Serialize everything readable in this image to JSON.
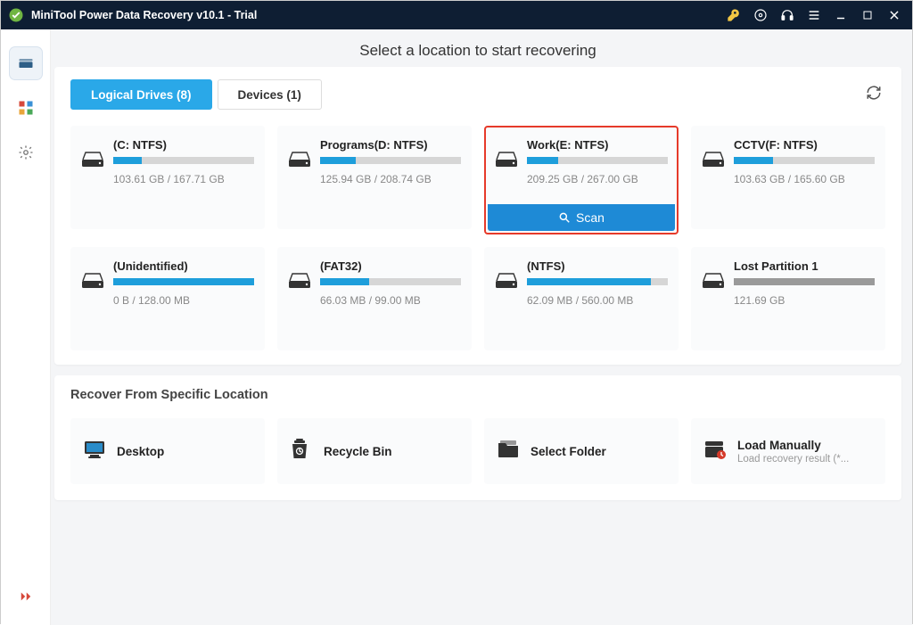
{
  "titlebar": {
    "title": "MiniTool Power Data Recovery v10.1 - Trial"
  },
  "heading": "Select a location to start recovering",
  "tabs": {
    "logical": "Logical Drives (8)",
    "devices": "Devices (1)"
  },
  "scan_label": "Scan",
  "drives": [
    {
      "name": "(C: NTFS)",
      "size": "103.61 GB / 167.71 GB",
      "fill": 20,
      "selected": false,
      "lost": false
    },
    {
      "name": "Programs(D: NTFS)",
      "size": "125.94 GB / 208.74 GB",
      "fill": 25,
      "selected": false,
      "lost": false
    },
    {
      "name": "Work(E: NTFS)",
      "size": "209.25 GB / 267.00 GB",
      "fill": 22,
      "selected": true,
      "lost": false
    },
    {
      "name": "CCTV(F: NTFS)",
      "size": "103.63 GB / 165.60 GB",
      "fill": 28,
      "selected": false,
      "lost": false
    },
    {
      "name": "(Unidentified)",
      "size": "0 B / 128.00 MB",
      "fill": 100,
      "selected": false,
      "lost": false
    },
    {
      "name": "(FAT32)",
      "size": "66.03 MB / 99.00 MB",
      "fill": 35,
      "selected": false,
      "lost": false
    },
    {
      "name": "(NTFS)",
      "size": "62.09 MB / 560.00 MB",
      "fill": 88,
      "selected": false,
      "lost": false
    },
    {
      "name": "Lost Partition 1",
      "size": "121.69 GB",
      "fill": 100,
      "selected": false,
      "lost": true
    }
  ],
  "recover_section_title": "Recover From Specific Location",
  "locations": [
    {
      "label": "Desktop",
      "sub": ""
    },
    {
      "label": "Recycle Bin",
      "sub": ""
    },
    {
      "label": "Select Folder",
      "sub": ""
    },
    {
      "label": "Load Manually",
      "sub": "Load recovery result (*..."
    }
  ]
}
